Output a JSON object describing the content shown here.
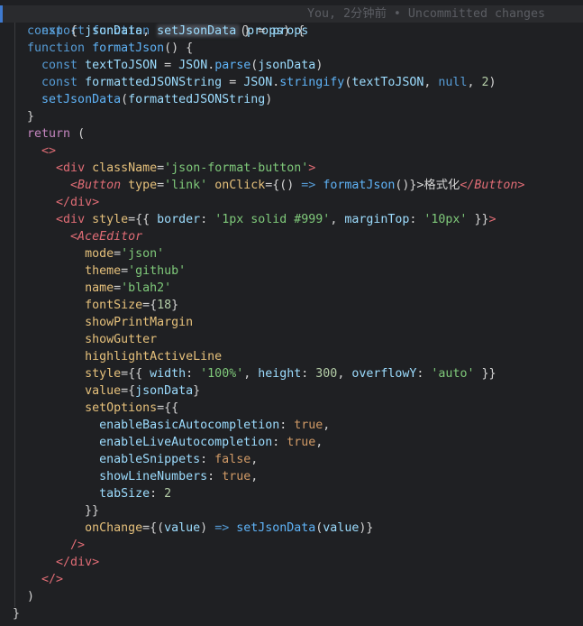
{
  "editor": {
    "redacted_name": "",
    "blame_text": "You, 2分钟前 • Uncommitted changes",
    "button_label": "格式化"
  }
}
